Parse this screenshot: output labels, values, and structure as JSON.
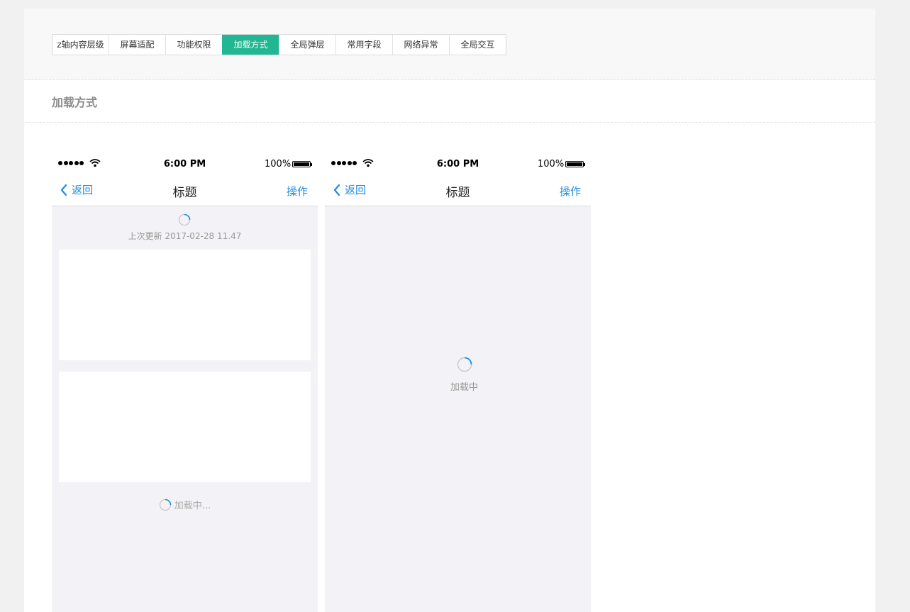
{
  "tabs": [
    {
      "label": "z轴内容层级",
      "active": false
    },
    {
      "label": "屏幕适配",
      "active": false
    },
    {
      "label": "功能权限",
      "active": false
    },
    {
      "label": "加载方式",
      "active": true
    },
    {
      "label": "全局弹层",
      "active": false
    },
    {
      "label": "常用字段",
      "active": false
    },
    {
      "label": "网络异常",
      "active": false
    },
    {
      "label": "全局交互",
      "active": false
    }
  ],
  "section": {
    "title": "加载方式"
  },
  "phone1": {
    "status": {
      "time": "6:00 PM",
      "battery": "100%"
    },
    "nav": {
      "back": "返回",
      "title": "标题",
      "action": "操作"
    },
    "last_update": "上次更新 2017-02-28 11.47",
    "load_more": "加载中..."
  },
  "phone2": {
    "status": {
      "time": "6:00 PM",
      "battery": "100%"
    },
    "nav": {
      "back": "返回",
      "title": "标题",
      "action": "操作"
    },
    "loading": "加载中"
  },
  "colors": {
    "accent": "#22b793",
    "link": "#1d8ce0",
    "phone_bg": "#f3f3f7"
  }
}
